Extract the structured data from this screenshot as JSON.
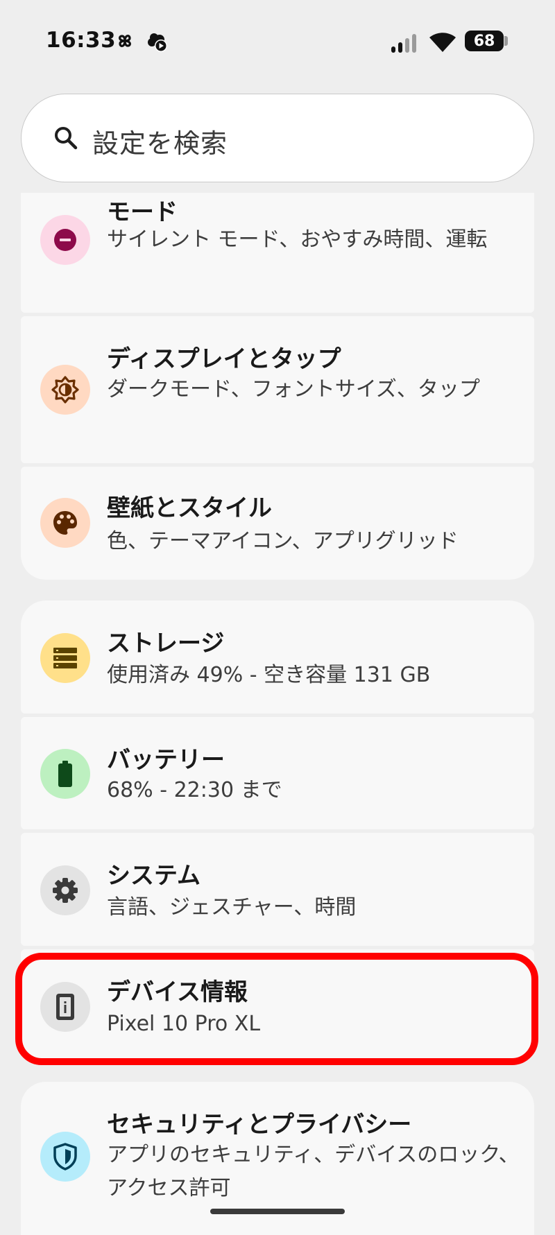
{
  "status_bar": {
    "time": "16:33",
    "battery_level": "68",
    "icons": [
      "pinwheel-icon",
      "weather-play-icon",
      "signal-icon",
      "wifi-icon",
      "battery-icon"
    ]
  },
  "search": {
    "placeholder": "設定を検索",
    "value": ""
  },
  "items": [
    {
      "title": "モード",
      "subtitle": "サイレント モード、おやすみ時間、運転",
      "icon": "dnd-minus-icon",
      "icon_bg": "#fcd7e6",
      "icon_color": "#8d0a4a"
    },
    {
      "title": "ディスプレイとタップ",
      "subtitle": "ダークモード、フォントサイズ、タップ",
      "icon": "brightness-icon",
      "icon_bg": "#ffd9c2",
      "icon_color": "#6a2f00"
    },
    {
      "title": "壁紙とスタイル",
      "subtitle": "色、テーマアイコン、アプリグリッド",
      "icon": "palette-icon",
      "icon_bg": "#ffd9c2",
      "icon_color": "#5a2700"
    },
    {
      "title": "ストレージ",
      "subtitle": "使用済み 49% - 空き容量 131 GB",
      "icon": "storage-icon",
      "icon_bg": "#ffe08a",
      "icon_color": "#5a4300"
    },
    {
      "title": "バッテリー",
      "subtitle": "68% - 22:30 まで",
      "icon": "battery-icon",
      "icon_bg": "#bdf0c0",
      "icon_color": "#0e4a1a"
    },
    {
      "title": "システム",
      "subtitle": "言語、ジェスチャー、時間",
      "icon": "gear-icon",
      "icon_bg": "#e3e3e3",
      "icon_color": "#3a3a3a"
    },
    {
      "title": "デバイス情報",
      "subtitle": "Pixel 10 Pro XL",
      "icon": "device-info-icon",
      "icon_bg": "#e3e3e3",
      "icon_color": "#3a3a3a"
    },
    {
      "title": "セキュリティとプライバシー",
      "subtitle": "アプリのセキュリティ、デバイスのロック、アクセス許可",
      "icon": "shield-icon",
      "icon_bg": "#b5ecfb",
      "icon_color": "#003f57"
    }
  ],
  "highlight_color": "#ff0000"
}
